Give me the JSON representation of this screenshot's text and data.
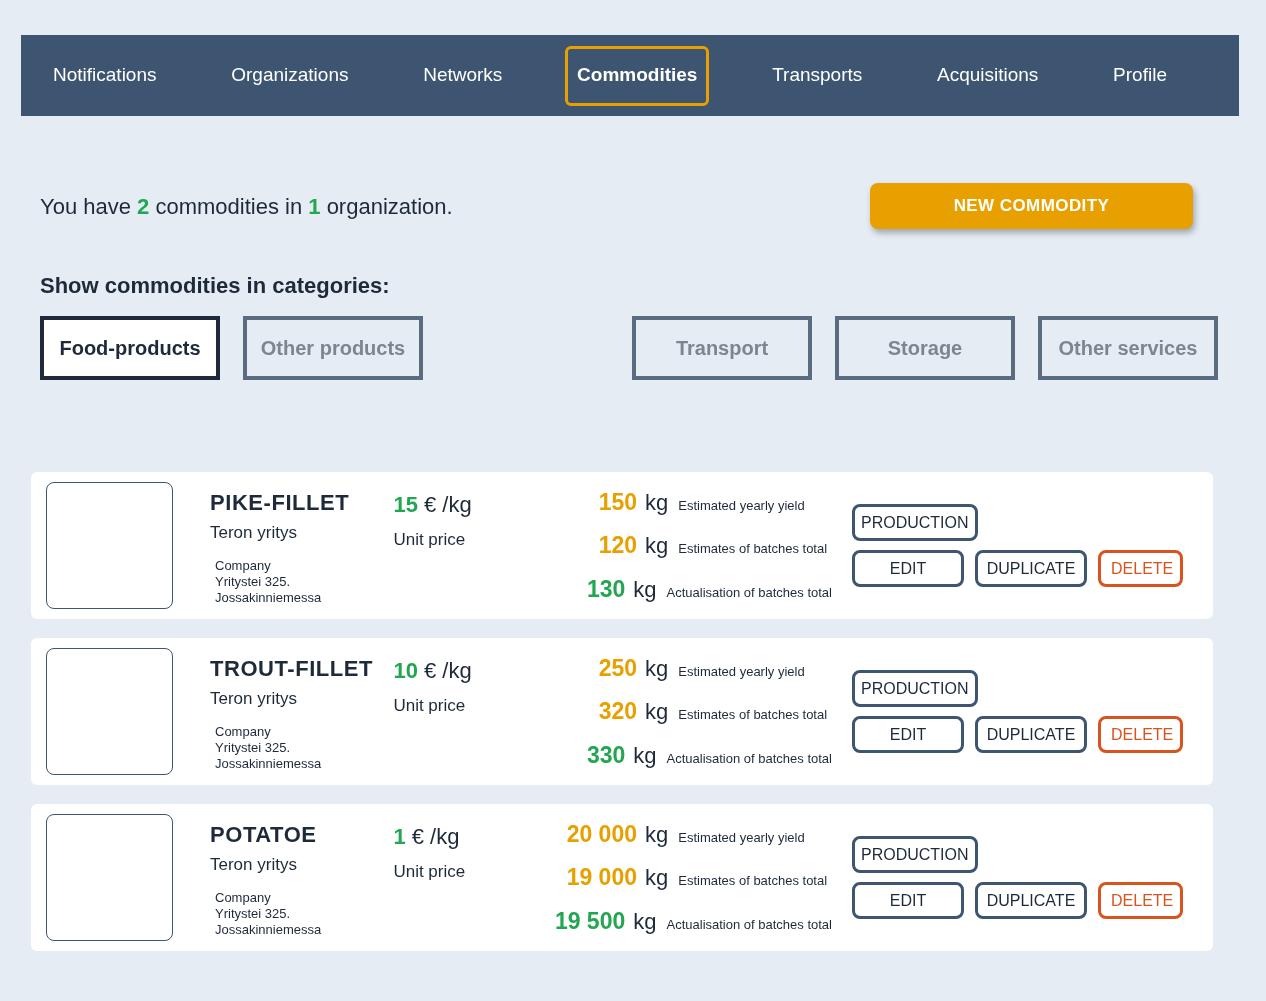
{
  "nav": {
    "tabs": [
      {
        "label": "Notifications",
        "selected": false
      },
      {
        "label": "Organizations",
        "selected": false
      },
      {
        "label": "Networks",
        "selected": false
      },
      {
        "label": "Commodities",
        "selected": true
      },
      {
        "label": "Transports",
        "selected": false
      },
      {
        "label": "Acquisitions",
        "selected": false
      },
      {
        "label": "Profile",
        "selected": false
      }
    ]
  },
  "summary": {
    "parts": [
      {
        "kind": "text",
        "text": "You have "
      },
      {
        "kind": "count",
        "text": "2"
      },
      {
        "kind": "text",
        "text": " commodities in "
      },
      {
        "kind": "count",
        "text": "1"
      },
      {
        "kind": "text",
        "text": " organization."
      }
    ]
  },
  "new_button": "NEW COMMODITY",
  "categories_title": "Show commodities in categories:",
  "product_categories": [
    {
      "label": "Food-products",
      "selected": true
    },
    {
      "label": "Other products",
      "selected": false
    }
  ],
  "service_categories": [
    {
      "label": "Transport",
      "selected": false
    },
    {
      "label": "Storage",
      "selected": false
    },
    {
      "label": "Other services",
      "selected": false
    }
  ],
  "commodities": [
    {
      "name": "PIKE-FILLET",
      "company": "Teron yritys",
      "address": [
        "Company",
        "Yritystei 325.",
        "Jossakinniemessa"
      ],
      "price": "15",
      "price_unit": "€ /kg",
      "price_label": "Unit price",
      "stats": [
        {
          "value": "150",
          "unit": "kg",
          "label": "Estimated yearly yield",
          "color": "#e8a000"
        },
        {
          "value": "120",
          "unit": "kg",
          "label": "Estimates of batches total",
          "color": "#e8a000"
        },
        {
          "value": "130",
          "unit": "kg",
          "label": "Actualisation of batches total",
          "color": "#22a652"
        }
      ],
      "buttons": [
        {
          "label": "PRODUCTION",
          "kind": "normal"
        },
        {
          "label": "EDIT",
          "kind": "normal"
        },
        {
          "label": "DUPLICATE",
          "kind": "normal"
        },
        {
          "label": "DELETE",
          "kind": "danger"
        }
      ]
    },
    {
      "name": "TROUT-FILLET",
      "company": "Teron yritys",
      "address": [
        "Company",
        "Yritystei 325.",
        "Jossakinniemessa"
      ],
      "price": "10",
      "price_unit": "€ /kg",
      "price_label": "Unit price",
      "stats": [
        {
          "value": "250",
          "unit": "kg",
          "label": "Estimated yearly yield",
          "color": "#e8a000"
        },
        {
          "value": "320",
          "unit": "kg",
          "label": "Estimates of batches total",
          "color": "#e8a000"
        },
        {
          "value": "330",
          "unit": "kg",
          "label": "Actualisation of batches total",
          "color": "#22a652"
        }
      ],
      "buttons": [
        {
          "label": "PRODUCTION",
          "kind": "normal"
        },
        {
          "label": "EDIT",
          "kind": "normal"
        },
        {
          "label": "DUPLICATE",
          "kind": "normal"
        },
        {
          "label": "DELETE",
          "kind": "danger"
        }
      ]
    },
    {
      "name": "POTATOE",
      "company": "Teron yritys",
      "address": [
        "Company",
        "Yritystei 325.",
        "Jossakinniemessa"
      ],
      "price": "1",
      "price_unit": "€ /kg",
      "price_label": "Unit price",
      "stats": [
        {
          "value": "20 000",
          "unit": "kg",
          "label": "Estimated yearly yield",
          "color": "#e8a000"
        },
        {
          "value": "19 000",
          "unit": "kg",
          "label": "Estimates of batches total",
          "color": "#e8a000"
        },
        {
          "value": "19 500",
          "unit": "kg",
          "label": "Actualisation of batches total",
          "color": "#22a652"
        }
      ],
      "buttons": [
        {
          "label": "PRODUCTION",
          "kind": "normal"
        },
        {
          "label": "EDIT",
          "kind": "normal"
        },
        {
          "label": "DUPLICATE",
          "kind": "normal"
        },
        {
          "label": "DELETE",
          "kind": "danger"
        }
      ]
    }
  ]
}
